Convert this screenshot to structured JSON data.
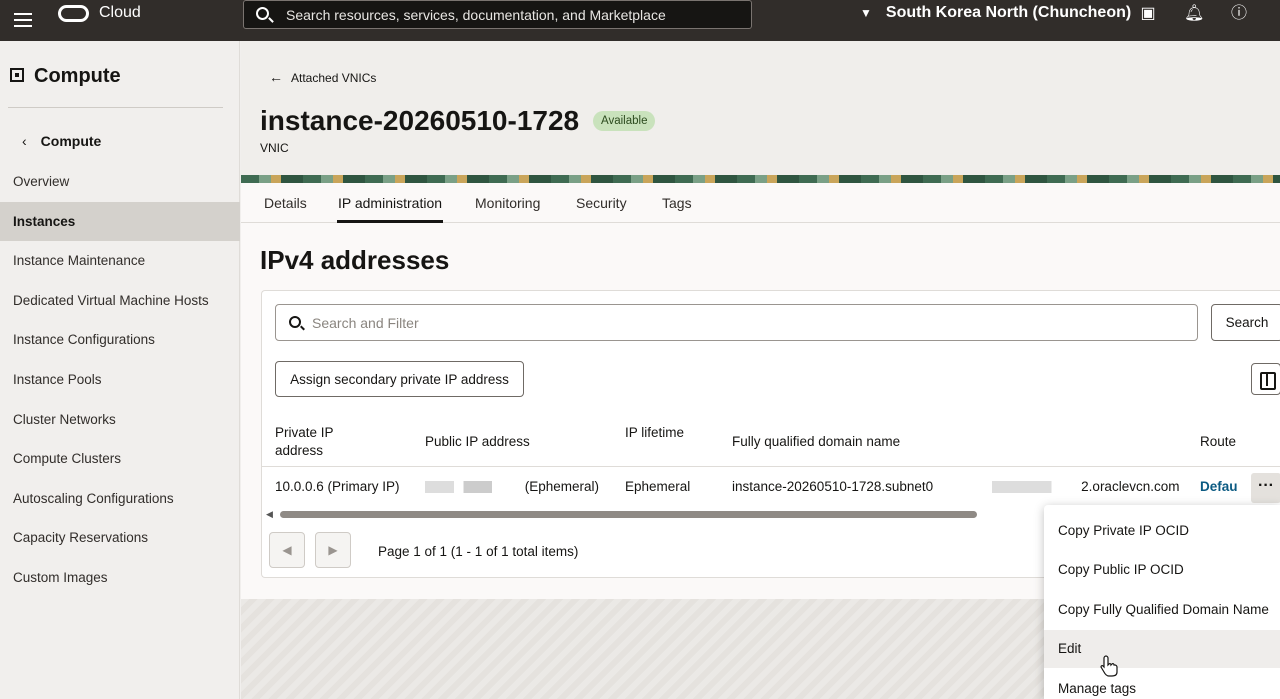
{
  "topbar": {
    "brand": "Cloud",
    "search_placeholder": "Search resources, services, documentation, and Marketplace",
    "region": "South Korea North (Chuncheon)"
  },
  "sidebar": {
    "title": "Compute",
    "back_label": "Compute",
    "items": [
      {
        "label": "Overview",
        "active": false
      },
      {
        "label": "Instances",
        "active": true
      },
      {
        "label": "Instance Maintenance",
        "active": false
      },
      {
        "label": "Dedicated Virtual Machine Hosts",
        "active": false
      },
      {
        "label": "Instance Configurations",
        "active": false
      },
      {
        "label": "Instance Pools",
        "active": false
      },
      {
        "label": "Cluster Networks",
        "active": false
      },
      {
        "label": "Compute Clusters",
        "active": false
      },
      {
        "label": "Autoscaling Configurations",
        "active": false
      },
      {
        "label": "Capacity Reservations",
        "active": false
      },
      {
        "label": "Custom Images",
        "active": false
      }
    ]
  },
  "header": {
    "back_link": "Attached VNICs",
    "title": "instance-20260510-1728",
    "status": "Available",
    "subtitle": "VNIC"
  },
  "tabs": [
    "Details",
    "IP administration",
    "Monitoring",
    "Security",
    "Tags"
  ],
  "active_tab": "IP administration",
  "section": {
    "title": "IPv4 addresses",
    "filter_placeholder": "Search and Filter",
    "search_button": "Search",
    "assign_button": "Assign secondary private IP address"
  },
  "table": {
    "headers": {
      "private_ip": "Private IP address",
      "public_ip": "Public IP address",
      "ip_lifetime": "IP lifetime",
      "fqdn": "Fully qualified domain name",
      "route": "Route"
    },
    "rows": [
      {
        "private_ip": "10.0.0.6 (Primary IP)",
        "public_ip_suffix": "(Ephemeral)",
        "ip_lifetime": "Ephemeral",
        "fqdn_prefix": "instance-20260510-1728.subnet0",
        "fqdn_suffix": "2.oraclevcn.com",
        "route": "Defau"
      }
    ],
    "pagination": "Page 1 of 1 (1 - 1 of 1 total items)"
  },
  "row_menu": {
    "items": [
      "Copy Private IP OCID",
      "Copy Public IP OCID",
      "Copy Fully Qualified Domain Name",
      "Edit",
      "Manage tags"
    ],
    "hovered": "Edit"
  }
}
